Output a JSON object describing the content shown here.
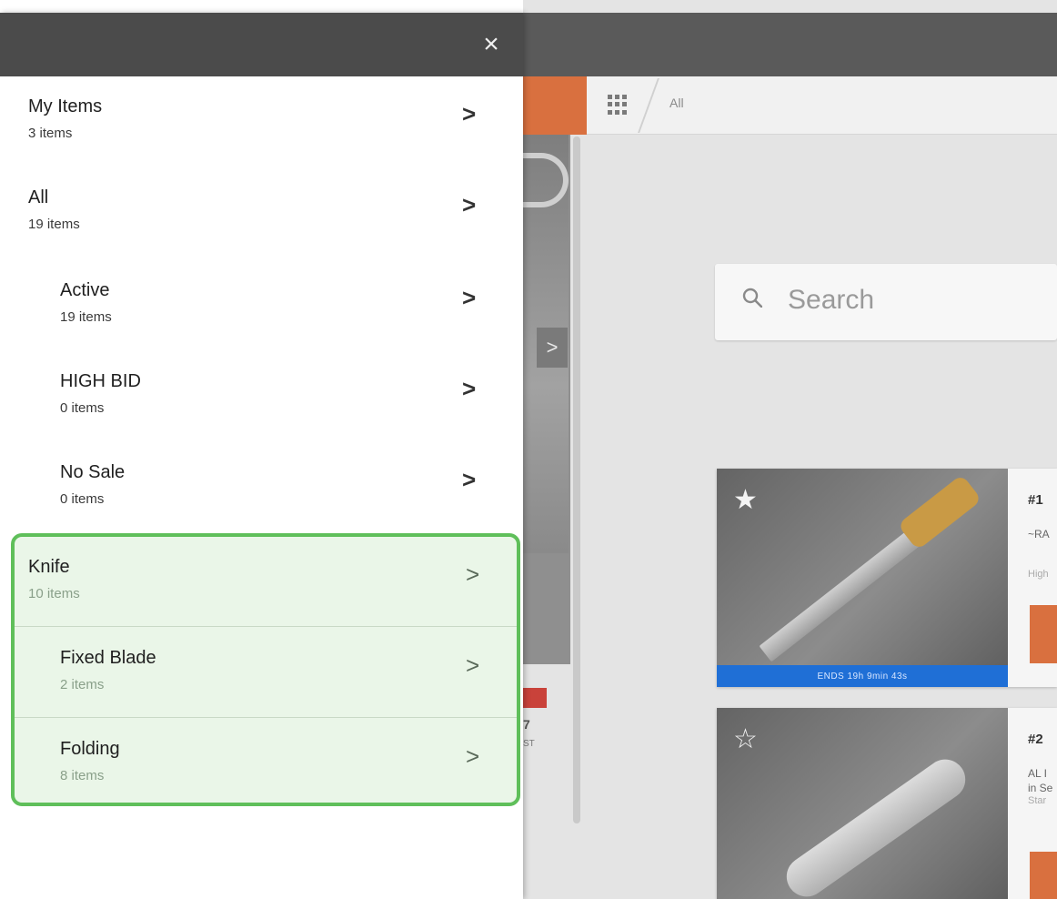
{
  "background": {
    "breadcrumb": "All",
    "search_placeholder": "Search",
    "side_arrow": ">",
    "side_number": "7",
    "side_label": "ST",
    "cards": [
      {
        "number": "#1",
        "subtitle": "~RA",
        "meta": "High",
        "ends": "ENDS 19h 9min 43s",
        "starred": true
      },
      {
        "number": "#2",
        "subtitle_lines": [
          "AL I",
          "in Se"
        ],
        "meta": "Star",
        "starred": false
      }
    ]
  },
  "drawer": {
    "close_label": "×",
    "items": [
      {
        "title": "My Items",
        "count": "3 items"
      },
      {
        "title": "All",
        "count": "19 items"
      },
      {
        "title": "Active",
        "count": "19 items"
      },
      {
        "title": "HIGH BID",
        "count": "0 items"
      },
      {
        "title": "No Sale",
        "count": "0 items"
      }
    ],
    "category": {
      "title": "Knife",
      "count": "10 items",
      "children": [
        {
          "title": "Fixed Blade",
          "count": "2 items"
        },
        {
          "title": "Folding",
          "count": "8 items"
        }
      ]
    },
    "chevron": ">"
  },
  "colors": {
    "accent_orange": "#d9703f",
    "timer_blue": "#1f6fd6",
    "highlight_green": "#5fbf5a",
    "header_gray": "#4b4b4b"
  },
  "icons": [
    "close-icon",
    "chevron-right-icon",
    "grid-icon",
    "search-icon",
    "star-filled-icon",
    "star-outline-icon"
  ]
}
